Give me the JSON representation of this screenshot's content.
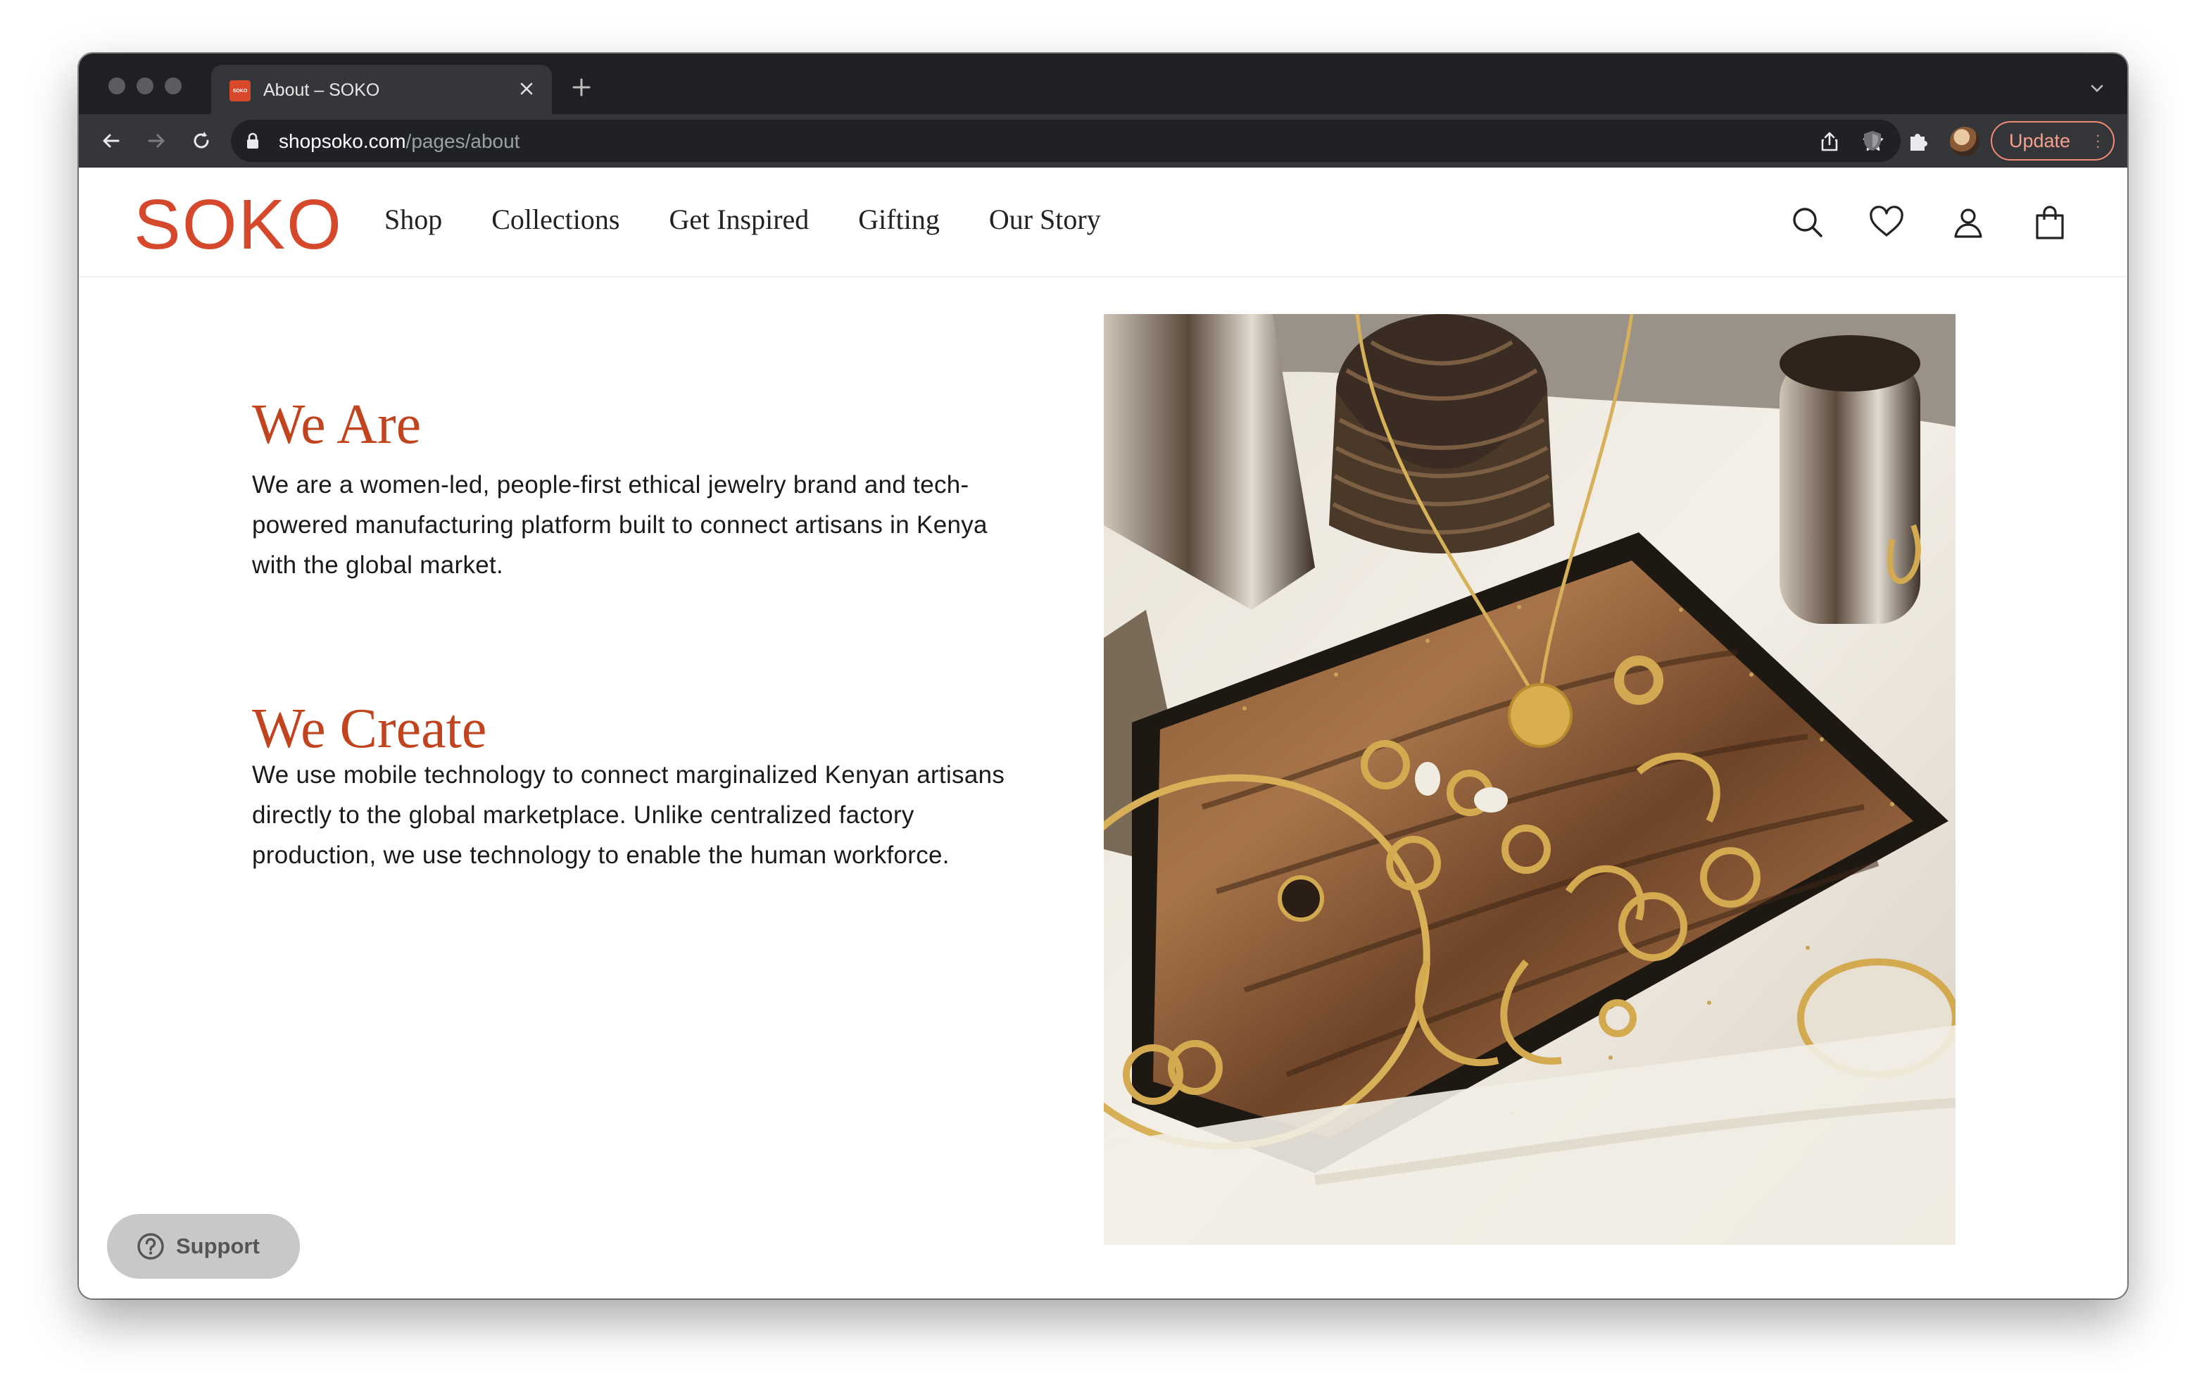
{
  "browser": {
    "tab_title": "About – SOKO",
    "favicon_text": "SOKO",
    "url_host": "shopsoko.com",
    "url_path": "/pages/about",
    "update_label": "Update"
  },
  "header": {
    "logo": "SOKO",
    "nav": [
      "Shop",
      "Collections",
      "Get Inspired",
      "Gifting",
      "Our Story"
    ]
  },
  "sections": [
    {
      "title": "We Are",
      "body": "We are a women-led, people-first ethical jewelry brand and tech-powered manufacturing platform built to connect artisans in Kenya with the global market."
    },
    {
      "title": "We Create",
      "body": "We use mobile technology to connect marginalized Kenyan artisans directly to the global marketplace. Unlike centralized factory production, we use technology to enable the human workforce."
    }
  ],
  "support_label": "Support",
  "colors": {
    "brand": "#d5482b",
    "heading": "#c2441f",
    "update": "#f08a74"
  }
}
